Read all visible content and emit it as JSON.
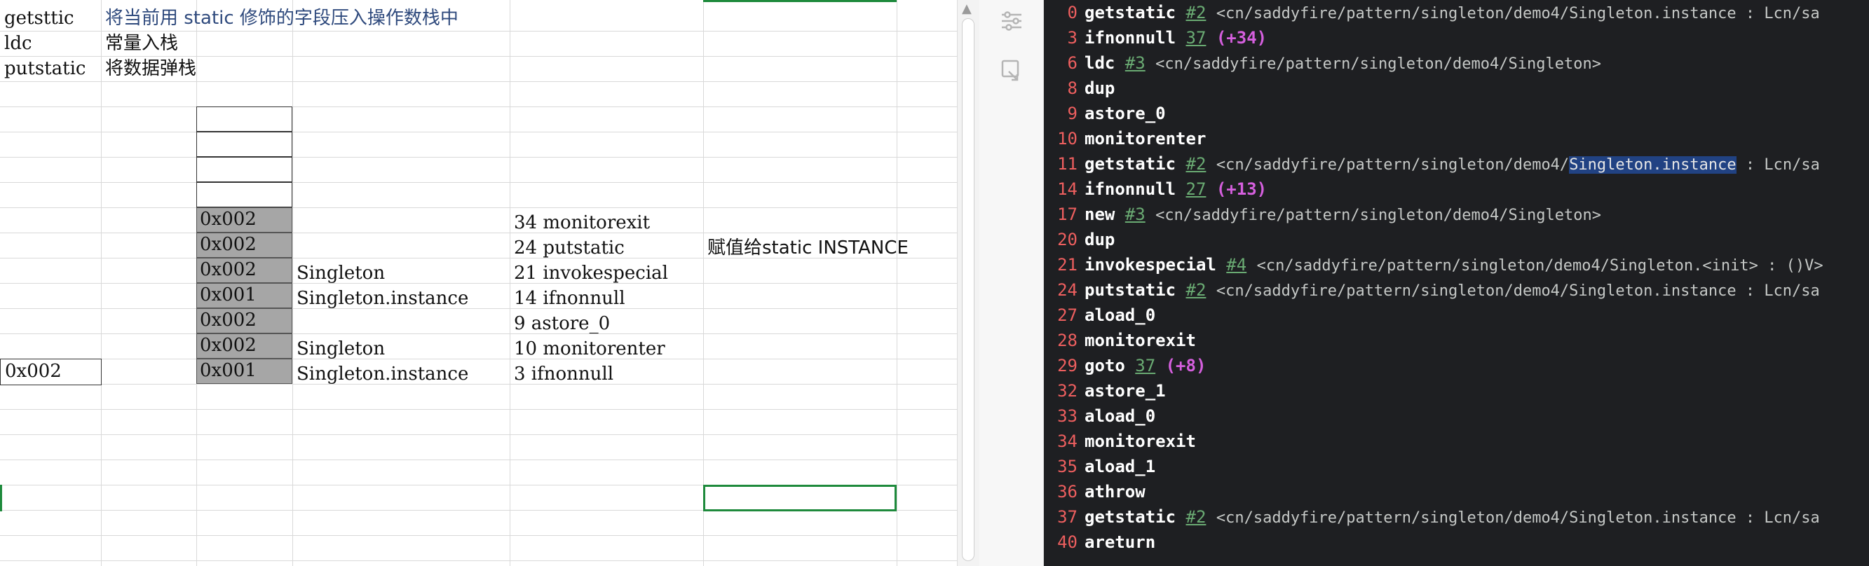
{
  "sheet": {
    "legend": [
      {
        "op": "getsttic",
        "desc": "将当前用 static 修饰的字段压入操作数栈中"
      },
      {
        "op": "ldc",
        "desc": "常量入栈"
      },
      {
        "op": "putstatic",
        "desc": "将数据弹栈"
      }
    ],
    "stack_cells": [
      "",
      "",
      "",
      "",
      "0x002",
      "0x002",
      "0x002",
      "0x001",
      "0x002",
      "0x002",
      "0x001"
    ],
    "labels": [
      "",
      "",
      "",
      "",
      "",
      "",
      "Singleton",
      "Singleton.instance",
      "",
      "Singleton",
      "Singleton.instance"
    ],
    "instructions": [
      "",
      "",
      "",
      "",
      "34 monitorexit",
      "24 putstatic",
      "21 invokespecial",
      "14 ifnonnull",
      "9 astore_0",
      "10 monitorenter",
      "3 ifnonnull"
    ],
    "note": "赋值给static INSTANCE",
    "ref_cell": "0x002"
  },
  "code": {
    "lines": [
      {
        "n": "0",
        "op": "getstatic",
        "ref": "#2",
        "off": "",
        "desc": "<cn/saddyfire/pattern/singleton/demo4/Singleton.instance : Lcn/sa"
      },
      {
        "n": "3",
        "op": "ifnonnull",
        "ref": "37",
        "off": "(+34)",
        "desc": ""
      },
      {
        "n": "6",
        "op": "ldc",
        "ref": "#3",
        "off": "",
        "desc": "<cn/saddyfire/pattern/singleton/demo4/Singleton>"
      },
      {
        "n": "8",
        "op": "dup",
        "ref": "",
        "off": "",
        "desc": ""
      },
      {
        "n": "9",
        "op": "astore_0",
        "ref": "",
        "off": "",
        "desc": ""
      },
      {
        "n": "10",
        "op": "monitorenter",
        "ref": "",
        "off": "",
        "desc": ""
      },
      {
        "n": "11",
        "op": "getstatic",
        "ref": "#2",
        "off": "",
        "desc": "<cn/saddyfire/pattern/singleton/demo4/",
        "hl": "Singleton.instance",
        "tail": " : Lcn/sa"
      },
      {
        "n": "14",
        "op": "ifnonnull",
        "ref": "27",
        "off": "(+13)",
        "desc": ""
      },
      {
        "n": "17",
        "op": "new",
        "ref": "#3",
        "off": "",
        "desc": "<cn/saddyfire/pattern/singleton/demo4/Singleton>"
      },
      {
        "n": "20",
        "op": "dup",
        "ref": "",
        "off": "",
        "desc": ""
      },
      {
        "n": "21",
        "op": "invokespecial",
        "ref": "#4",
        "off": "",
        "desc": "<cn/saddyfire/pattern/singleton/demo4/Singleton.<init> : ()V>"
      },
      {
        "n": "24",
        "op": "putstatic",
        "ref": "#2",
        "off": "",
        "desc": "<cn/saddyfire/pattern/singleton/demo4/Singleton.instance : Lcn/sa"
      },
      {
        "n": "27",
        "op": "aload_0",
        "ref": "",
        "off": "",
        "desc": ""
      },
      {
        "n": "28",
        "op": "monitorexit",
        "ref": "",
        "off": "",
        "desc": ""
      },
      {
        "n": "29",
        "op": "goto",
        "ref": "37",
        "off": "(+8)",
        "desc": ""
      },
      {
        "n": "32",
        "op": "astore_1",
        "ref": "",
        "off": "",
        "desc": ""
      },
      {
        "n": "33",
        "op": "aload_0",
        "ref": "",
        "off": "",
        "desc": ""
      },
      {
        "n": "34",
        "op": "monitorexit",
        "ref": "",
        "off": "",
        "desc": ""
      },
      {
        "n": "35",
        "op": "aload_1",
        "ref": "",
        "off": "",
        "desc": ""
      },
      {
        "n": "36",
        "op": "athrow",
        "ref": "",
        "off": "",
        "desc": ""
      },
      {
        "n": "37",
        "op": "getstatic",
        "ref": "#2",
        "off": "",
        "desc": "<cn/saddyfire/pattern/singleton/demo4/Singleton.instance : Lcn/sa"
      },
      {
        "n": "40",
        "op": "areturn",
        "ref": "",
        "off": "",
        "desc": ""
      }
    ]
  },
  "icons": {
    "scroll_up": "caret-up-icon",
    "tool1": "sliders-icon",
    "tool2": "refresh-icon"
  },
  "colors": {
    "editor_bg": "#1e1f22",
    "line_number": "#ee5f5f",
    "reference": "#6aab73",
    "offset": "#d55fde",
    "selection": "#214283",
    "active_cell": "#1e8a3c"
  }
}
